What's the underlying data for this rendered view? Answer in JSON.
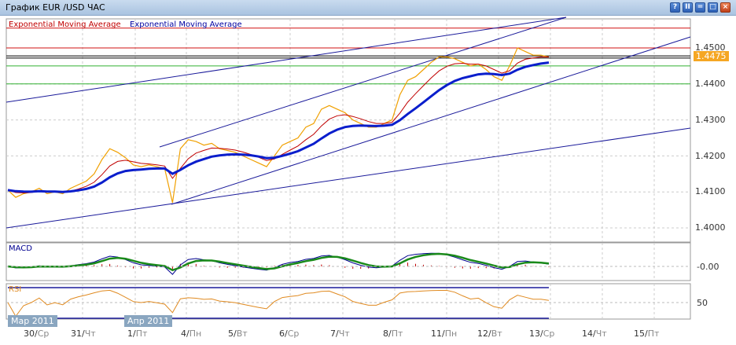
{
  "window": {
    "title": "График EUR /USD  ЧАС",
    "buttons": [
      "?",
      "II",
      "=",
      "□",
      "×"
    ]
  },
  "legend": {
    "ema1": "Exponential  Moving  Average",
    "ema2": "Exponential  Moving  Average",
    "ema1_color": "#c00000",
    "ema2_color": "#0000a0"
  },
  "price_axis": {
    "ticks": [
      "1.4500",
      "1.4400",
      "1.4300",
      "1.4200",
      "1.4100",
      "1.4000"
    ],
    "current": "1.4475"
  },
  "levels": {
    "red": [
      1.4555,
      1.45
    ],
    "black": [
      1.4478,
      1.4472
    ],
    "green": [
      1.445,
      1.44
    ]
  },
  "macd": {
    "label": "MACD",
    "tick": "-0.00"
  },
  "rsi": {
    "label": "RSI",
    "tick": "50"
  },
  "months": [
    "Мар 2011",
    "Апр 2011"
  ],
  "dates": [
    {
      "d": "30/",
      "w": "Ср"
    },
    {
      "d": "31/",
      "w": "Чт"
    },
    {
      "d": "1/",
      "w": "Пт"
    },
    {
      "d": "4/",
      "w": "Пн"
    },
    {
      "d": "5/",
      "w": "Вт"
    },
    {
      "d": "6/",
      "w": "Ср"
    },
    {
      "d": "7/",
      "w": "Чт"
    },
    {
      "d": "8/",
      "w": "Пт"
    },
    {
      "d": "11/",
      "w": "Пн"
    },
    {
      "d": "12/",
      "w": "Вт"
    },
    {
      "d": "13/",
      "w": "Ср"
    },
    {
      "d": "14/",
      "w": "Чт"
    },
    {
      "d": "15/",
      "w": "Пт"
    }
  ],
  "chart_data": {
    "type": "line",
    "title": "EUR/USD hourly",
    "ylim": [
      1.3975,
      1.457
    ],
    "series": [
      {
        "name": "EUR/USD",
        "color": "#f0a000",
        "values": [
          1.4105,
          1.4085,
          1.4095,
          1.41,
          1.411,
          1.4095,
          1.41,
          1.4095,
          1.411,
          1.412,
          1.413,
          1.415,
          1.419,
          1.422,
          1.421,
          1.4195,
          1.4175,
          1.417,
          1.4175,
          1.417,
          1.4165,
          1.407,
          1.422,
          1.4245,
          1.424,
          1.423,
          1.4235,
          1.422,
          1.4215,
          1.421,
          1.42,
          1.419,
          1.418,
          1.417,
          1.42,
          1.423,
          1.424,
          1.425,
          1.428,
          1.429,
          1.433,
          1.434,
          1.433,
          1.432,
          1.43,
          1.429,
          1.428,
          1.428,
          1.429,
          1.43,
          1.437,
          1.441,
          1.442,
          1.444,
          1.446,
          1.4475,
          1.4475,
          1.447,
          1.446,
          1.445,
          1.4455,
          1.444,
          1.442,
          1.441,
          1.445,
          1.45,
          1.449,
          1.448,
          1.448,
          1.4475
        ]
      }
    ]
  }
}
